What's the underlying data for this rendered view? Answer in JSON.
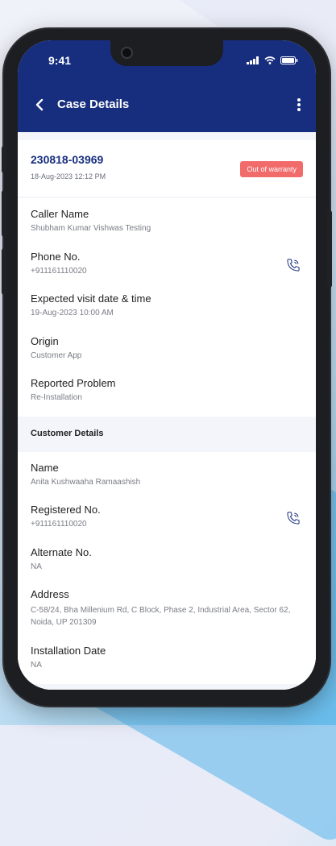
{
  "status_bar": {
    "time": "9:41"
  },
  "app_bar": {
    "title": "Case Details"
  },
  "case": {
    "id": "230818-03969",
    "datetime": "18-Aug-2023  12:12 PM",
    "badge": "Out of warranty"
  },
  "case_fields": [
    {
      "label": "Caller Name",
      "value": "Shubham Kumar Vishwas Testing"
    },
    {
      "label": "Phone No.",
      "value": "+911161110020"
    },
    {
      "label": "Expected visit date & time",
      "value": "19-Aug-2023 10:00 AM"
    },
    {
      "label": "Origin",
      "value": "Customer App"
    },
    {
      "label": "Reported Problem",
      "value": "Re-Installation"
    }
  ],
  "customer_section": {
    "title": "Customer Details",
    "fields": [
      {
        "label": "Name",
        "value": "Anita Kushwaaha Ramaashish"
      },
      {
        "label": "Registered No.",
        "value": "+911161110020"
      },
      {
        "label": "Alternate No.",
        "value": "NA"
      },
      {
        "label": "Address",
        "value": "C-58/24, Bha Millenium Rd, C Block, Phase 2, Industrial Area, Sector 62, Noida, UP 201309"
      },
      {
        "label": "Installation Date",
        "value": "NA"
      }
    ]
  },
  "colors": {
    "header": "#172e7e",
    "badge": "#f26b6b",
    "link": "#172e7e"
  },
  "icons": [
    "back-arrow-icon",
    "more-vertical-icon",
    "phone-call-icon",
    "signal-icon",
    "wifi-icon",
    "battery-icon"
  ]
}
